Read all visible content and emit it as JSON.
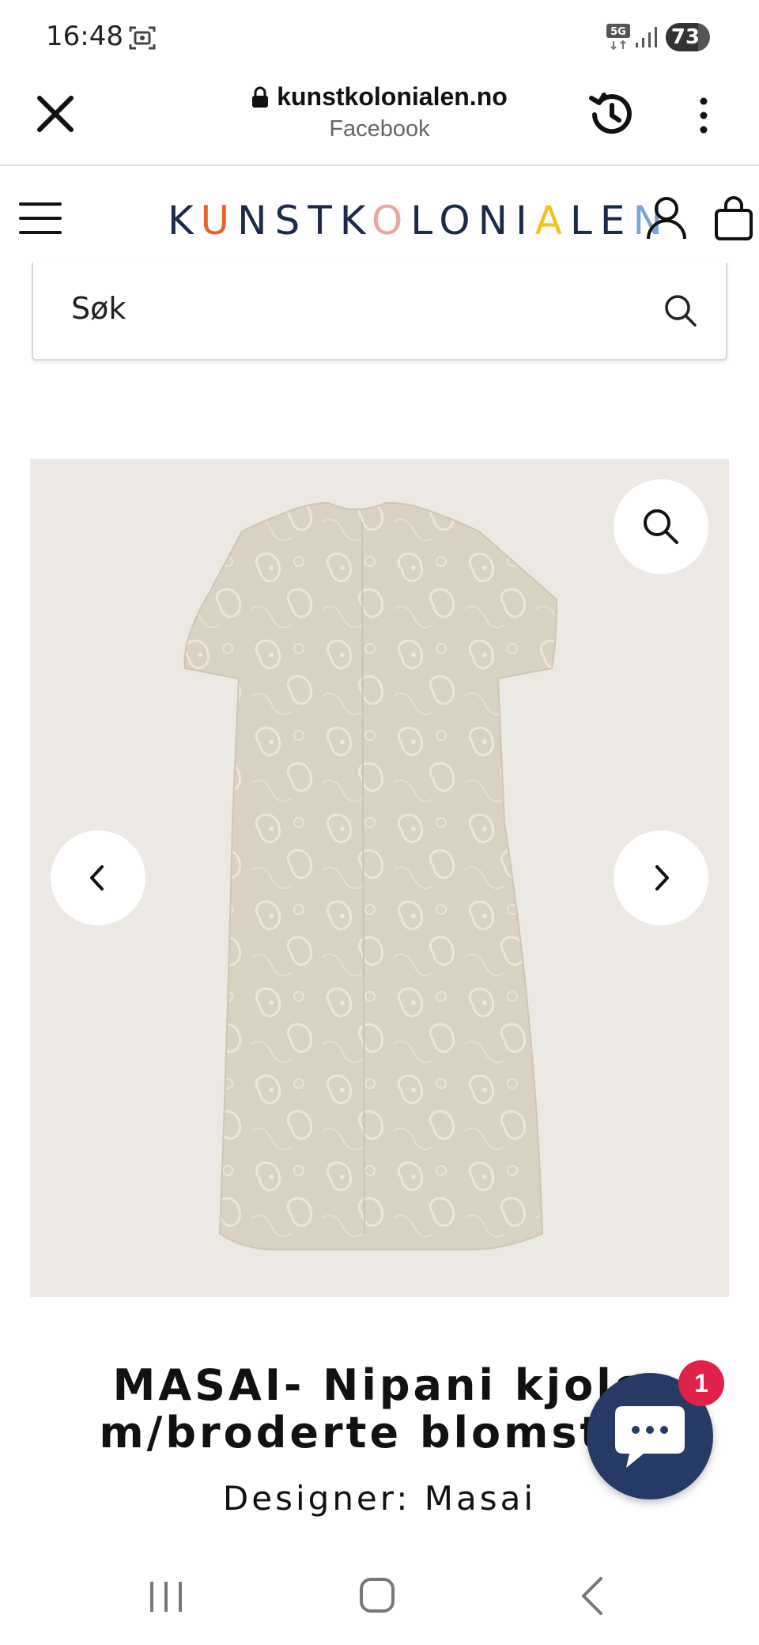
{
  "status_bar": {
    "time": "16:48",
    "network": "5G",
    "battery": "73",
    "battery_level": 0.73
  },
  "browser": {
    "url": "kunstkolonialen.no",
    "source": "Facebook"
  },
  "site": {
    "logo_letters": [
      {
        "ch": "K",
        "color": "#1c2a4a"
      },
      {
        "ch": "U",
        "color": "#e8622c"
      },
      {
        "ch": "N",
        "color": "#1c2a4a"
      },
      {
        "ch": "S",
        "color": "#1c2a4a"
      },
      {
        "ch": "T",
        "color": "#1c2a4a"
      },
      {
        "ch": "K",
        "color": "#1c2a4a"
      },
      {
        "ch": "O",
        "color": "#e9a7a1"
      },
      {
        "ch": "L",
        "color": "#1c2a4a"
      },
      {
        "ch": "O",
        "color": "#1c2a4a"
      },
      {
        "ch": "N",
        "color": "#1c2a4a"
      },
      {
        "ch": "I",
        "color": "#1c2a4a"
      },
      {
        "ch": "A",
        "color": "#f1c31a"
      },
      {
        "ch": "L",
        "color": "#1c2a4a"
      },
      {
        "ch": "E",
        "color": "#1c2a4a"
      },
      {
        "ch": "N",
        "color": "#7aa3d8"
      }
    ]
  },
  "search": {
    "placeholder": "Søk"
  },
  "product": {
    "title": "MASAI- Nipani kjole\nm/broderte blomster",
    "designer": "Designer: Masai"
  },
  "chat": {
    "badge": "1"
  },
  "icons": {
    "close": "close-icon",
    "lock": "lock-icon",
    "history": "history-icon",
    "more": "more-vertical-icon",
    "menu": "hamburger-menu-icon",
    "account": "user-icon",
    "cart": "shopping-bag-icon",
    "search": "search-icon",
    "zoom": "zoom-icon",
    "prev": "chevron-left-icon",
    "next": "chevron-right-icon",
    "chat": "chat-bubble-icon"
  }
}
